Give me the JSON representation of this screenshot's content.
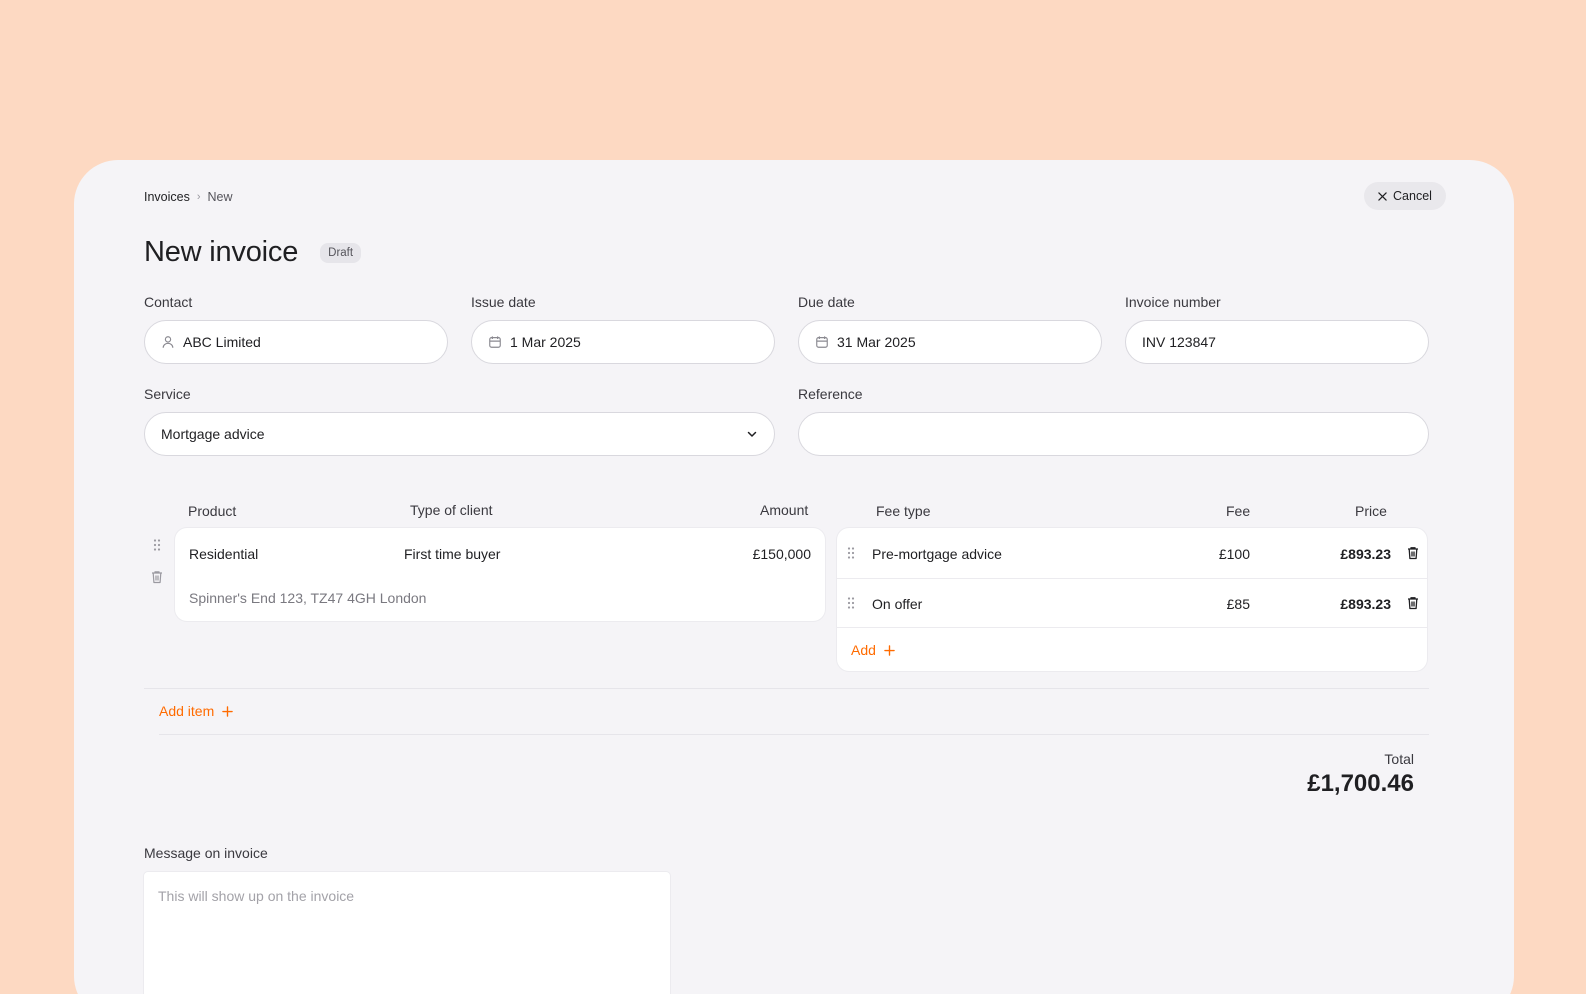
{
  "breadcrumb": {
    "root": "Invoices",
    "separator": "›",
    "current": "New"
  },
  "cancel": {
    "label": "Cancel",
    "icon": "close-icon"
  },
  "header": {
    "title": "New invoice",
    "status_badge": "Draft"
  },
  "form": {
    "contact": {
      "label": "Contact",
      "value": "ABC Limited",
      "icon": "user-icon"
    },
    "issue_date": {
      "label": "Issue date",
      "value": "1 Mar 2025",
      "icon": "calendar-icon"
    },
    "due_date": {
      "label": "Due date",
      "value": "31 Mar 2025",
      "icon": "calendar-icon"
    },
    "invoice_number": {
      "label": "Invoice number",
      "value": "INV 123847"
    },
    "service": {
      "label": "Service",
      "value": "Mortgage advice",
      "icon": "chevron-down-icon"
    },
    "reference": {
      "label": "Reference",
      "value": ""
    }
  },
  "product_table": {
    "headers": {
      "product": "Product",
      "client_type": "Type of client",
      "amount": "Amount"
    },
    "rows": [
      {
        "product": "Residential",
        "client_type": "First time buyer",
        "amount": "£150,000",
        "address": "Spinner's End 123, TZ47 4GH London"
      }
    ]
  },
  "fee_table": {
    "headers": {
      "fee_type": "Fee type",
      "fee": "Fee",
      "price": "Price"
    },
    "rows": [
      {
        "fee_type": "Pre-mortgage advice",
        "fee": "£100",
        "price": "£893.23"
      },
      {
        "fee_type": "On offer",
        "fee": "£85",
        "price": "£893.23"
      }
    ],
    "add_label": "Add"
  },
  "add_item_label": "Add item",
  "totals": {
    "label": "Total",
    "value": "£1,700.46"
  },
  "message": {
    "label": "Message on invoice",
    "placeholder": "This will show up on the invoice"
  },
  "colors": {
    "background": "#fdd9c2",
    "panel": "#f5f4f7",
    "accent": "#ff6b00"
  }
}
